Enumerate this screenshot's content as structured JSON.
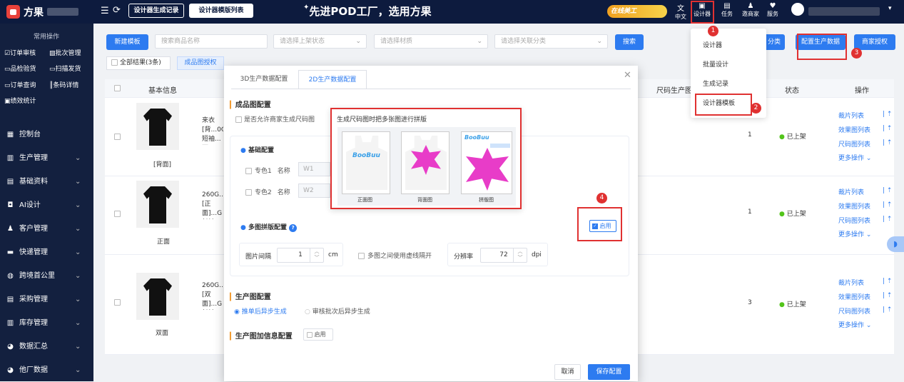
{
  "brand": {
    "name": "方果"
  },
  "topbar": {
    "tab1": "设计器生成记录",
    "tab2": "设计器模版列表",
    "slogan": "先进POD工厂，选用方果",
    "badge": "在线美工",
    "icons": [
      {
        "name": "translate-icon",
        "label": "中文"
      },
      {
        "name": "designer-icon",
        "label": "设计器"
      },
      {
        "name": "task-icon",
        "label": "任务"
      },
      {
        "name": "invite-icon",
        "label": "邀商家"
      },
      {
        "name": "service-icon",
        "label": "服务"
      }
    ]
  },
  "sidebar": {
    "section": "常用操作",
    "quick": [
      "订单审核",
      "批次管理",
      "品检验货",
      "扫描发货",
      "订单查询",
      "条码详情",
      "绩效统计"
    ],
    "menu": [
      "控制台",
      "生产管理",
      "基础资料",
      "AI设计",
      "客户管理",
      "快递管理",
      "跨境首公里",
      "采购管理",
      "库存管理",
      "数据汇总",
      "他厂数据"
    ]
  },
  "toolbar": {
    "new": "新建模板",
    "search_ph": "搜索商品名称",
    "status_ph": "请选择上架状态",
    "material_ph": "请选择材质",
    "category_ph": "请选择关联分类",
    "search": "搜索",
    "cat_btn": "分类",
    "config_btn": "配置生产数据",
    "merchant_btn": "商家授权"
  },
  "filter": {
    "all": "全部结果(3条)",
    "tab": "成品图授权"
  },
  "table": {
    "headers": {
      "info": "基本信息",
      "size": "尺码生产图",
      "status": "状态",
      "ops": "操作"
    },
    "rows": [
      {
        "caption": "[背面]",
        "text": "来衣[背...0G短袖...面],500...",
        "count": "1",
        "status": "已上架"
      },
      {
        "caption": "正面",
        "text": "260G...[正面]...G长袖...",
        "count": "1",
        "status": "已上架"
      },
      {
        "caption": "双面",
        "text": "260G...[双面]...G长袖...",
        "count": "3",
        "status": "已上架"
      }
    ],
    "ops": [
      "裁片列表",
      "效果图列表",
      "尺码图列表",
      "更多操作"
    ]
  },
  "menu": {
    "items": [
      "设计器",
      "批量设计",
      "生成记录",
      "设计器模板"
    ]
  },
  "dialog": {
    "tab1": "3D生产数据配置",
    "tab2": "2D生产数据配置",
    "sec1": "成品图配置",
    "allow": "是否允许商家生成尺码图",
    "basic": "基础配置",
    "spot1": "专色1",
    "spot2": "专色2",
    "name_lbl": "名称",
    "w1": "W1",
    "w2": "W2",
    "multi": "多图拼版配置",
    "enable": "启用",
    "gap_lbl": "图片间隔",
    "gap_val": "1",
    "cm": "cm",
    "dashed": "多图之间使用虚线隔开",
    "dpi_lbl": "分辨率",
    "dpi_val": "72",
    "dpi": "dpi",
    "sec2": "生产图配置",
    "r1": "推单后异步生成",
    "r2": "审核批次后异步生成",
    "sec3": "生产图加信息配置",
    "enable2": "启用",
    "cancel": "取消",
    "save": "保存配置",
    "preview": {
      "title": "生成尺码图时把多张图进行拼版",
      "front": "正面图",
      "back": "背面图",
      "combined": "拼版图",
      "art": "BooBuu"
    }
  },
  "markers": [
    "1",
    "2",
    "3",
    "4"
  ],
  "colors": {
    "accent": "#2d7bf0",
    "red": "#e03131",
    "status_green": "#52c41a",
    "magenta": "#e83cc8"
  }
}
